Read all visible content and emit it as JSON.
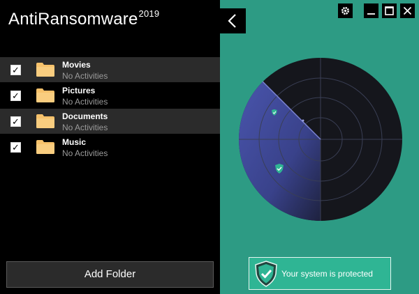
{
  "app": {
    "title": "AntiRansomware",
    "year": "2019"
  },
  "folders": [
    {
      "name": "Movies",
      "status": "No Activities",
      "checked": true
    },
    {
      "name": "Pictures",
      "status": "No Activities",
      "checked": true
    },
    {
      "name": "Documents",
      "status": "No Activities",
      "checked": true
    },
    {
      "name": "Music",
      "status": "No Activities",
      "checked": true
    }
  ],
  "checkmark": "✓",
  "add_folder_label": "Add Folder",
  "status_message": "Your system is protected",
  "colors": {
    "panel_bg": "#000000",
    "accent_teal": "#2d9b84",
    "status_green": "#2fb594",
    "folder_yellow": "#f7c26b",
    "radar_sweep": "#4a55a8"
  },
  "icons": {
    "back": "chevron-left-icon",
    "settings": "gear-icon",
    "minimize": "minimize-icon",
    "maximize": "maximize-icon",
    "close": "close-icon",
    "folder": "folder-icon",
    "shield": "shield-check-icon"
  }
}
